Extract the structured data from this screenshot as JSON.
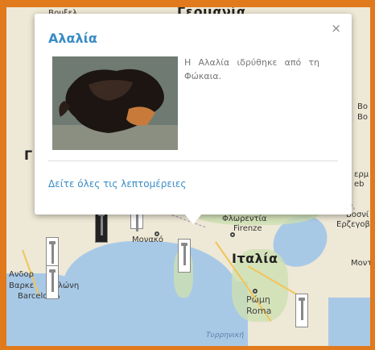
{
  "map": {
    "labels": {
      "germany": "Γερμανία",
      "brussels_partial": "Βρυξελ",
      "france_partial": "Γ",
      "florence_gr": "Φλωρεντία",
      "florence_it": "Firenze",
      "monaco": "Μονακό",
      "italy": "Ιταλία",
      "andorra": "Ανδορ",
      "barcelona_gr": "Βαρκε",
      "barcelona_gr2": "λώνη",
      "barcelona_es": "Barcelona",
      "rome_gr": "Ρώμη",
      "rome_it": "Roma",
      "tyrrhenian_gr": "Τυρρηνική",
      "bosnia_gr": "Βοσνί",
      "herzegovina_gr": "Ερζεγοβ",
      "montenegro_partial": "Μοντ",
      "right_edge_1": "Βο",
      "right_edge_2": "Bo",
      "right_edge_3": "ερμ",
      "right_edge_4": "eb"
    }
  },
  "popup": {
    "title": "Αλαλία",
    "close_symbol": "×",
    "description": "Η Αλαλία ιδρύθηκε από τη Φώκαια.",
    "details_link": "Δείτε όλες τις λεπτομέρειες",
    "image_alt": "Αρχαίο αγγείο"
  },
  "colors": {
    "frame": "#e07a1c",
    "link": "#3a8cc5",
    "sea": "#a8c9e6",
    "land": "#eee8d6"
  }
}
